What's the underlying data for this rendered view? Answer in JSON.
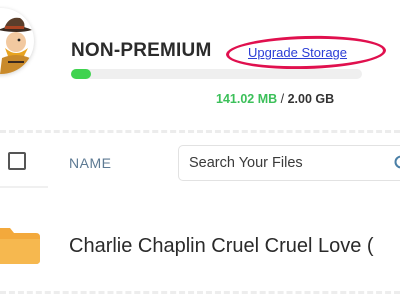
{
  "account": {
    "plan": "NON-PREMIUM",
    "upgrade_label": "Upgrade Storage",
    "used": "141.02 MB",
    "separator": " / ",
    "total": "2.00 GB",
    "usage_fraction": 0.07
  },
  "table": {
    "name_header": "NAME",
    "search_placeholder": "Search Your Files"
  },
  "files": [
    {
      "name": "Charlie Chaplin Cruel Cruel Love (",
      "icon": "folder-icon"
    }
  ],
  "colors": {
    "usage_bar": "#3fd34f",
    "used_text": "#3cc05a",
    "link": "#2c3ed6",
    "highlight_ring": "#e0104e",
    "folder": "#f3a93c"
  },
  "icons": [
    "cowboy-avatar",
    "search-icon",
    "folder-icon",
    "checkbox"
  ]
}
